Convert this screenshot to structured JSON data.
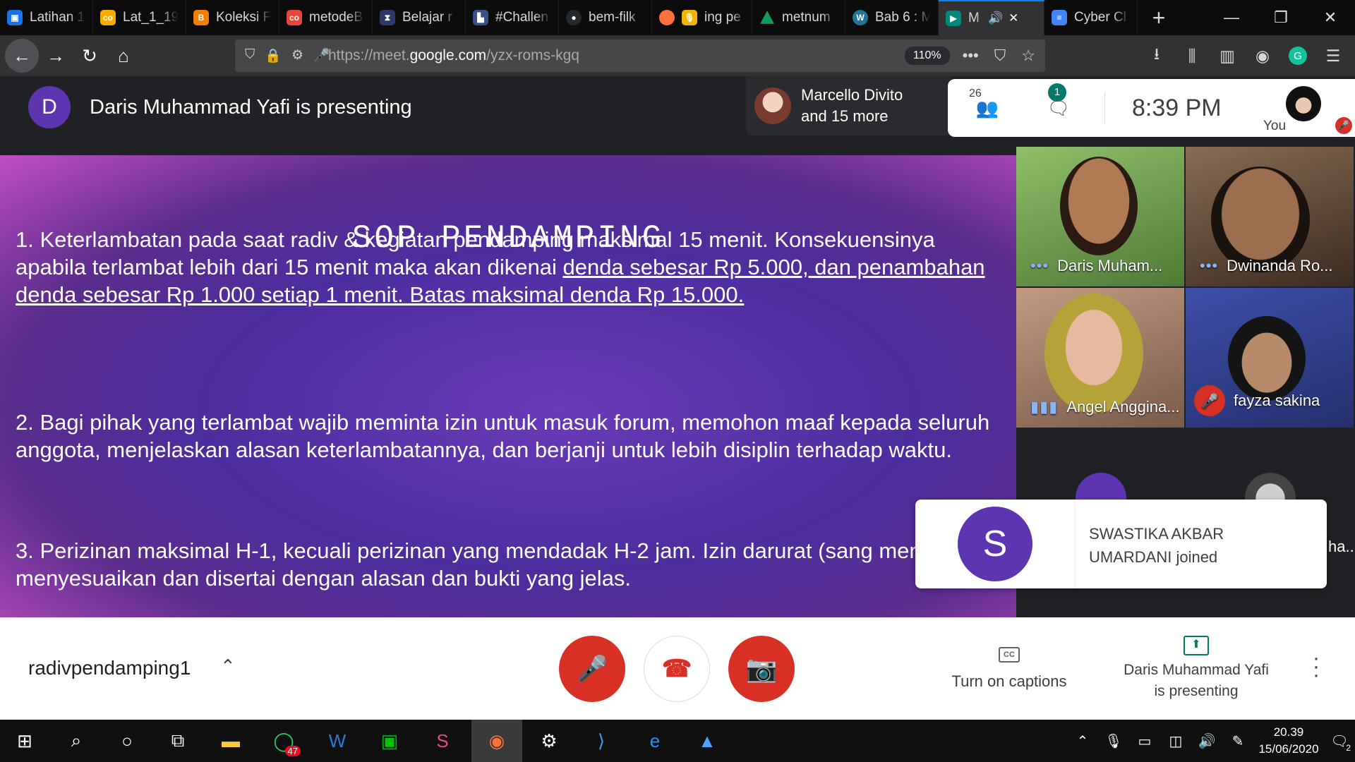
{
  "browser": {
    "tabs": [
      {
        "title": "Latihan 1",
        "icon": "latihan-favicon",
        "color": "#1a73e8"
      },
      {
        "title": "Lat_1_19",
        "icon": "colab-favicon",
        "color": "#f9ab00"
      },
      {
        "title": "Koleksi F",
        "icon": "blogger-favicon",
        "color": "#f57d00"
      },
      {
        "title": "metodeB",
        "icon": "colab-favicon",
        "color": "#e8453c"
      },
      {
        "title": "Belajar r",
        "icon": "belajar-favicon",
        "color": "#2b3a67"
      },
      {
        "title": "#Challen",
        "icon": "challenge-favicon",
        "color": "#3b4f8a"
      },
      {
        "title": "bem-filk",
        "icon": "github-favicon",
        "color": "#24292e"
      },
      {
        "title": "ing pe",
        "icon": "firefox-favicon",
        "color": "#ff7139"
      },
      {
        "title": "metnum",
        "icon": "drive-favicon",
        "color": "#0f9d58"
      },
      {
        "title": "Bab 6 : M",
        "icon": "wordpress-favicon",
        "color": "#21759b"
      },
      {
        "title": "M",
        "icon": "meet-favicon",
        "color": "#00897b",
        "active": true
      },
      {
        "title": "Cyber Cl",
        "icon": "docs-favicon",
        "color": "#4285f4"
      }
    ],
    "url_prefix": "https://meet.",
    "url_domain": "google.com",
    "url_path": "/yzx-roms-kgq",
    "zoom": "110%"
  },
  "meet": {
    "presenter_initial": "D",
    "presenting_text": "Daris Muhammad Yafi is presenting",
    "speaker_line1": "Marcello Divito",
    "speaker_line2": "and 15 more",
    "people_count": "26",
    "chat_badge": "1",
    "time": "8:39  PM",
    "self_label": "You",
    "meeting_name": "radivpendamping1",
    "captions_label": "Turn on captions",
    "presenting_line1": "Daris Muhammad Yafi",
    "presenting_line2": "is presenting"
  },
  "slide": {
    "title": "SOP PENDAMPING",
    "p1_plain": "1. Keterlambatan pada saat radiv & kegiatan pendamping maksimal 15 menit. Konsekuensinya apabila terlambat lebih dari 15 menit maka akan dikenai ",
    "p1_underlined": "denda sebesar Rp 5.000, dan penambahan denda sebesar Rp 1.000 setiap 1 menit. Batas maksimal denda Rp 15.000.",
    "p2": "2. Bagi pihak yang terlambat wajib meminta izin untuk masuk forum, memohon maaf kepada seluruh anggota, menjelaskan alasan keterlambatannya, dan berjanji untuk lebih disiplin terhadap waktu.",
    "p3": "3. Perizinan maksimal H-1, kecuali perizinan yang mendadak  H-2 jam. Izin darurat (sang mendadak) menyesuaikan dan disertai dengan alasan dan bukti yang jelas."
  },
  "participants": [
    {
      "name": "Daris Muham...",
      "status": "speaking-dots"
    },
    {
      "name": "Dwinanda Ro...",
      "status": "speaking-dots"
    },
    {
      "name": "Angel Anggina...",
      "status": "audio-bars"
    },
    {
      "name": "fayza sakina",
      "status": "muted"
    }
  ],
  "hidden_participant": {
    "initial": "S",
    "name_fragment": "ha..."
  },
  "toast": {
    "initial": "S",
    "text_line1": "SWASTIKA AKBAR",
    "text_line2": "UMARDANI joined"
  },
  "taskbar": {
    "whatsapp_badge": "47",
    "clock_time": "20.39",
    "clock_date": "15/06/2020",
    "notif_count": "2"
  }
}
